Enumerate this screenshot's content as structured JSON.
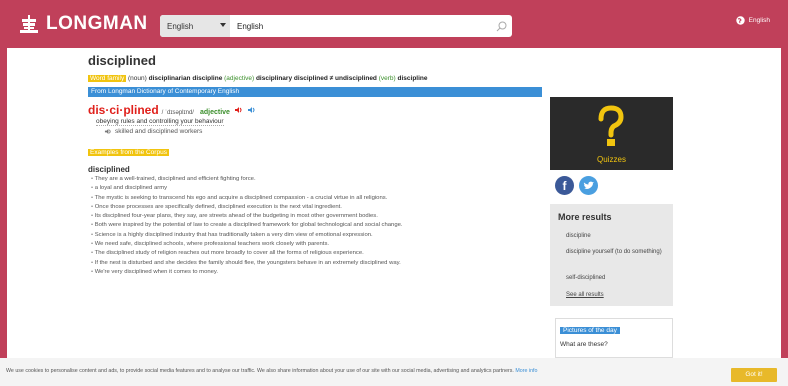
{
  "header": {
    "logo_text": "LONGMAN",
    "search": {
      "dictionary": "English",
      "query": "English"
    },
    "language": "English"
  },
  "headword": "disciplined",
  "word_family": {
    "tag": "Word family",
    "items": [
      {
        "pos": "(noun)",
        "words": [
          "disciplinarian",
          "discipline"
        ]
      },
      {
        "pos": "(adjective)",
        "words": [
          "disciplinary",
          "disciplined",
          "≠ undisciplined"
        ]
      },
      {
        "pos": "(verb)",
        "words": [
          "discipline"
        ]
      }
    ]
  },
  "source_bar": "From Longman Dictionary of Contemporary English",
  "entry": {
    "hyphenated": "dis·ci·plined",
    "pronunciation": "/ ˈdɪsəplɪnd/",
    "pos": "adjective",
    "definition": "obeying rules and controlling your behaviour",
    "example": "skilled and disciplined workers"
  },
  "corpus": {
    "tag": "Examples from the Corpus",
    "headword": "disciplined",
    "examples": [
      "They are a well-trained, disciplined and efficient fighting force.",
      "a loyal and disciplined army",
      "The mystic is seeking to transcend his ego and acquire a disciplined compassion - a crucial virtue in all religions.",
      "Once those processes are specifically defined, disciplined execution is the next vital ingredient.",
      "Its disciplined four-year plans, they say, are streets ahead of the budgeting in most other government bodies.",
      "Both were inspired by the potential of law to create a disciplined framework for global technological and social change.",
      "Science is a highly disciplined industry that has traditionally taken a very dim view of emotional expression.",
      "We need safe, disciplined schools, where professional teachers work closely with parents.",
      "The disciplined study of religion reaches out more broadly to cover all the forms of religious experience.",
      "If the nest is disturbed and she decides the family should flee, the youngsters behave in an extremely disciplined way.",
      "We're very disciplined when it comes to money."
    ]
  },
  "sidebar": {
    "quiz_label": "Quizzes",
    "more_results": {
      "title": "More results",
      "items": [
        "discipline",
        "discipline yourself (to do something)",
        "self-disciplined"
      ],
      "see_all": "See all results"
    },
    "pictures": {
      "tag": "Pictures of the day",
      "question": "What are these?"
    }
  },
  "cookie": {
    "text": "We use cookies to personalise content and ads, to provide social media features and to analyse our traffic. We also share information about your use of our site with our social media, advertising and analytics partners.",
    "link": "More info",
    "button": "Got it!"
  }
}
